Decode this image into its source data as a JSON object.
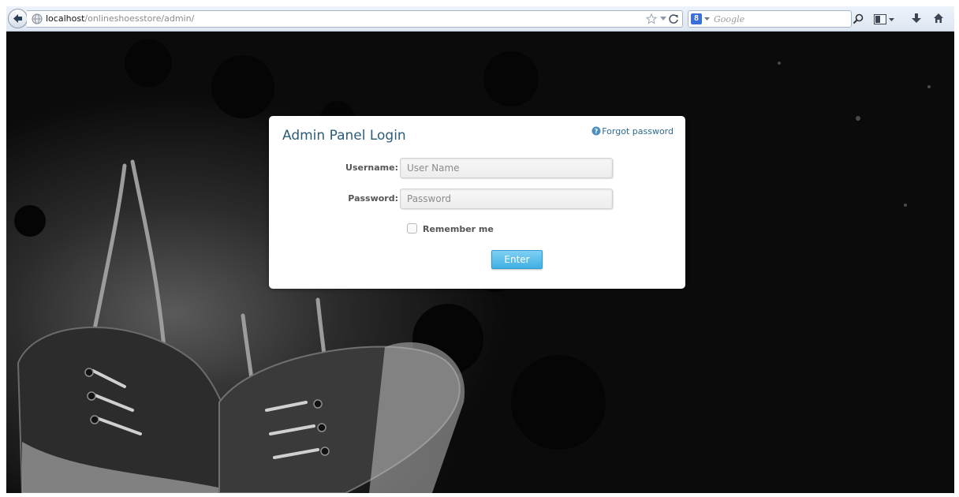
{
  "browser": {
    "url_host": "localhost",
    "url_path": "/onlineshoesstore/admin/",
    "search_placeholder": "Google",
    "search_engine_letter": "8"
  },
  "login": {
    "title": "Admin Panel Login",
    "forgot_password": "Forgot password",
    "username_label": "Username:",
    "username_placeholder": "User Name",
    "password_label": "Password:",
    "password_placeholder": "Password",
    "remember_label": "Remember me",
    "remember_checked": false,
    "enter_button": "Enter"
  },
  "colors": {
    "title": "#2b5d78",
    "button": "#3fb0e3",
    "page_background": "#0b0b0b"
  }
}
